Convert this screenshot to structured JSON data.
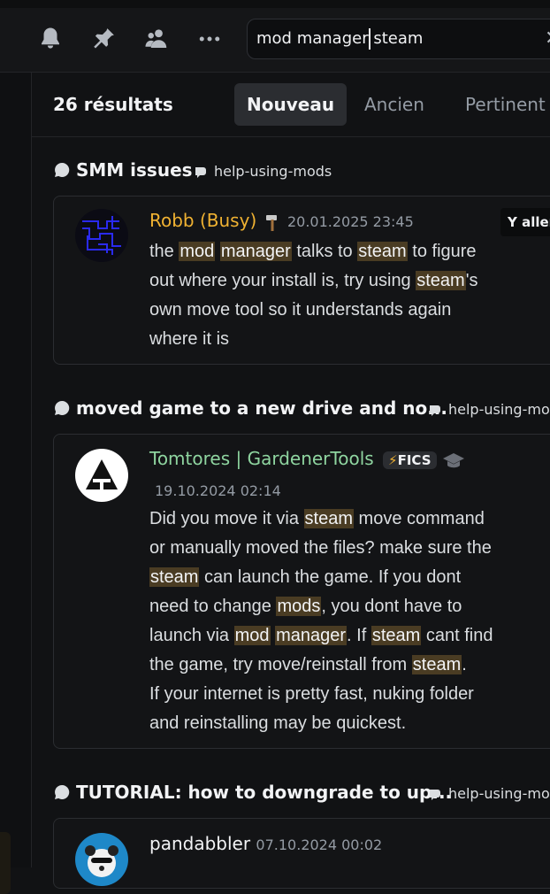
{
  "toolbar": {
    "icons": [
      "bell-icon",
      "pin-icon",
      "members-icon",
      "more-icon"
    ],
    "search_value": "mod manager steam"
  },
  "results": {
    "count_label": "26 résultats",
    "tabs": [
      {
        "label": "Nouveau",
        "active": true
      },
      {
        "label": "Ancien",
        "active": false
      },
      {
        "label": "Pertinent",
        "active": false
      }
    ],
    "items": [
      {
        "thread": "SMM issues",
        "channel": "help-using-mods",
        "author": "Robb (Busy)",
        "author_color": "#f0b232",
        "author_icon": "hammer-icon",
        "timestamp": "20.01.2025 23:45",
        "jump_label": "Y aller",
        "lines": [
          [
            "the ",
            {
              "hl": "mod"
            },
            " ",
            {
              "hl": "manager"
            },
            " talks to ",
            {
              "hl": "steam"
            },
            " to figure"
          ],
          [
            "out where your install is, try using ",
            {
              "hl": "steam"
            },
            "'s"
          ],
          [
            "own move tool so it understands again"
          ],
          [
            "where it is"
          ]
        ]
      },
      {
        "thread": "moved game to a new drive and no...",
        "channel": "help-using-mods",
        "author": "Tomtores | GardenerTools",
        "author_color": "#8fd5a0",
        "tag": "FICS",
        "tag_icon": "lightning-icon",
        "author_icon": "graduation-cap-icon",
        "timestamp": "19.10.2024 02:14",
        "lines": [
          [
            "Did you move it via ",
            {
              "hl": "steam"
            },
            " move command"
          ],
          [
            "or manually moved the files? make sure the"
          ],
          [
            {
              "hl": "steam"
            },
            " can launch the game. If you dont"
          ],
          [
            "need to change ",
            {
              "hl": "mods"
            },
            ", you dont have to"
          ],
          [
            "launch via ",
            {
              "hl": "mod"
            },
            " ",
            {
              "hl": "manager"
            },
            ". If ",
            {
              "hl": "steam"
            },
            " cant find"
          ],
          [
            "the game, try move/reinstall from ",
            {
              "hl": "steam"
            },
            "."
          ],
          [
            "If your internet is pretty fast, nuking folder"
          ],
          [
            "and reinstalling may be quickest."
          ]
        ]
      },
      {
        "thread": "TUTORIAL: how to downgrade to up...",
        "channel": "help-using-mods",
        "author": "pandabbler",
        "author_color": "#f2f3f5",
        "timestamp": "07.10.2024 00:02"
      }
    ]
  },
  "colors": {
    "highlight_bg": "#4a3c23",
    "bg": "#111214"
  }
}
